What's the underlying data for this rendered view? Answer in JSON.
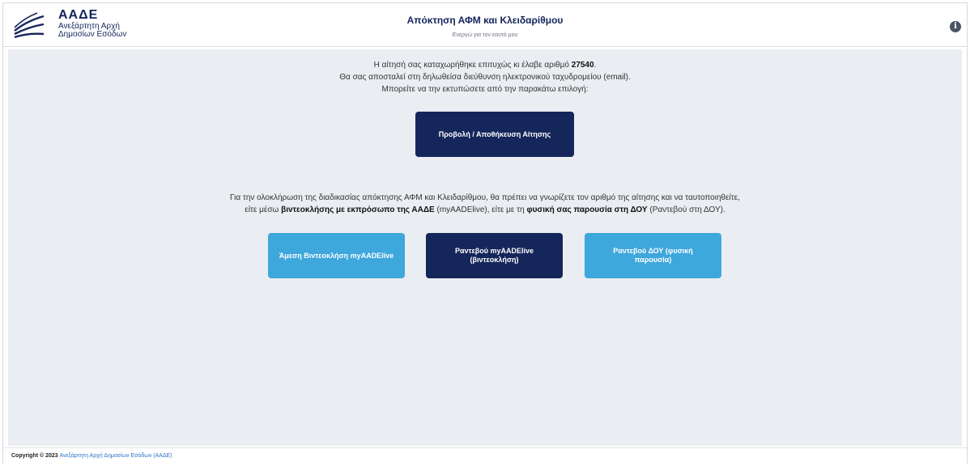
{
  "header": {
    "logo_name": "ΑΑΔΕ",
    "logo_sub_line1": "Ανεξάρτητη Αρχή",
    "logo_sub_line2": "Δημοσίων Εσόδων",
    "title": "Απόκτηση ΑΦΜ και Κλειδαρίθμου",
    "subtitle": "Ενεργώ για τον εαυτό μου"
  },
  "message": {
    "line1_prefix": "Η αίτησή σας καταχωρήθηκε επιτυχώς κι έλαβε αριθμό",
    "application_number": "27540",
    "line1_suffix": ".",
    "line2": "Θα σας αποσταλεί στη δηλωθείσα διεύθυνση ηλεκτρονικού ταχυδρομείου (email).",
    "line3": "Μπορείτε να την εκτυπώσετε από την παρακάτω επιλογή:"
  },
  "view_button_label": "Προβολή / Αποθήκευση Αίτησης",
  "completion": {
    "line1": "Για την ολοκλήρωση της διαδικασίας απόκτησης ΑΦΜ και Κλειδαρίθμου, θα πρέπει να γνωρίζετε τον αριθμό της αίτησης και να ταυτοποιηθείτε,",
    "line2_a": "είτε μέσω",
    "line2_b": "βιντεοκλήσης με εκπρόσωπο της ΑΑΔΕ",
    "line2_c": "(myAADElive), είτε με τη",
    "line2_d": "φυσική σας παρουσία στη ΔΟΥ",
    "line2_e": "(Ραντεβού στη ΔΟΥ)."
  },
  "actions": {
    "instant_video": "Άμεση Βιντεοκλήση myAADElive",
    "appointment_video_line1": "Ραντεβού myAADElive",
    "appointment_video_line2": "(βιντεοκλήση)",
    "appointment_doy_line1": "Ραντεβού ΔΟΥ (φυσική",
    "appointment_doy_line2": "παρουσία)"
  },
  "footer": {
    "copyright": "Copyright © 2023",
    "link": "Ανεξάρτητη Αρχή Δημοσίων Εσόδων (ΑΑΔΕ)"
  },
  "colors": {
    "primary_dark": "#15265b",
    "accent_light": "#3ea7dc",
    "background": "#eaedf1"
  },
  "icons": [
    "aade-logo-icon",
    "info-icon"
  ]
}
